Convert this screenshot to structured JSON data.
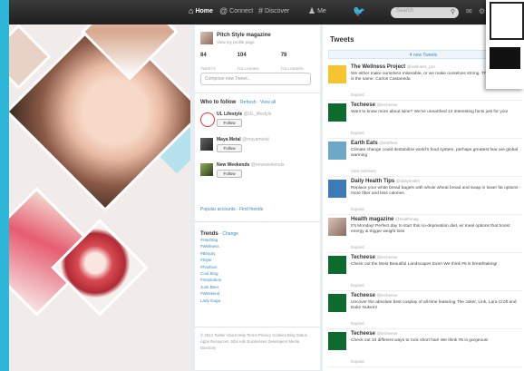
{
  "topbar": {
    "nav": [
      {
        "label": "Home",
        "icon": "home-icon"
      },
      {
        "label": "Connect",
        "icon": "at-icon"
      },
      {
        "label": "Discover",
        "icon": "hash-icon"
      },
      {
        "label": "Me",
        "icon": "person-icon"
      }
    ],
    "search_placeholder": "Search"
  },
  "profile": {
    "name": "Pitch Style magazine",
    "sub": "View my profile page",
    "stats": [
      {
        "value": "84",
        "label": "TWEETS"
      },
      {
        "value": "104",
        "label": "FOLLOWING"
      },
      {
        "value": "78",
        "label": "FOLLOWERS"
      }
    ],
    "compose_placeholder": "Compose new Tweet..."
  },
  "who_to_follow": {
    "title": "Who to follow",
    "links": "· Refresh · View all",
    "users": [
      {
        "name": "UL Lifestyle",
        "handle": "@UL_lifestyle",
        "button": "Follow"
      },
      {
        "name": "Maya Metal",
        "handle": "@mayametal",
        "button": "Follow"
      },
      {
        "name": "New Weekends",
        "handle": "@newweekends",
        "button": "Follow"
      }
    ],
    "popular": "Popular accounts · Find friends"
  },
  "trends": {
    "title": "Trends",
    "change": "· Change",
    "items": [
      "#Hashtag",
      "#Wellness",
      "#Beauty",
      "#Style",
      "#Fashion",
      "Cool Blog",
      "#Inspiration",
      "Junk Beer",
      "#Weekend",
      "Lady Gaga"
    ]
  },
  "footer": "© 2013 Twitter About Help Terms Privacy Cookies Blog Status Apps Resources Jobs Ads Businesses Developers Media Directory",
  "tweets": {
    "title": "Tweets",
    "new_tweets": "4 new Tweets",
    "items": [
      {
        "name": "The Wellness Project",
        "handle": "@wellness_pro",
        "text": "We either make ourselves miserable, or we make ourselves strong. The amount of work is the same. Carlos Castaneda",
        "expand": "Expand",
        "avatar": "yellow"
      },
      {
        "name": "Techeese",
        "handle": "@techeese",
        "text": "Want to know more about wine? We've unearthed 10 interesting facts just for you!",
        "expand": "Expand",
        "avatar": "green"
      },
      {
        "name": "Earth Eats",
        "handle": "@earthea",
        "text": "Climate change could destabilize world's food system, perhaps greatest fear are global warming",
        "expand": "View summary",
        "avatar": "earth"
      },
      {
        "name": "Daily Health Tips",
        "handle": "@dailyhealth",
        "text": "Replace your white bread bagels with whole wheat bread and swap in lower fat options - more fiber and less calories.",
        "expand": "Expand",
        "avatar": "blue"
      },
      {
        "name": "Health magazine",
        "handle": "@healthmag",
        "text": "It's Monday! Perfect day to start this no-deprivation diet, w/ meal options that boost energy & trigger weight loss",
        "expand": "Expand",
        "avatar": "photo"
      },
      {
        "name": "Techeese",
        "handle": "@techeese",
        "text": "Check out the Most Beautiful Landscapes Ever! We think #6 is breathtaking!",
        "expand": "Expand",
        "avatar": "green"
      },
      {
        "name": "Techeese",
        "handle": "@techeese",
        "text": "Uncover the absolute best cosplay of all-time featuring The Joker, Link, Lara Croft and Duke Nukem!",
        "expand": "Expand",
        "avatar": "green"
      },
      {
        "name": "Techeese",
        "handle": "@techeese",
        "text": "Check out 10 different ways to rock short hair! We think #5 is gorgeous!",
        "expand": "Expand",
        "avatar": "green"
      }
    ]
  }
}
